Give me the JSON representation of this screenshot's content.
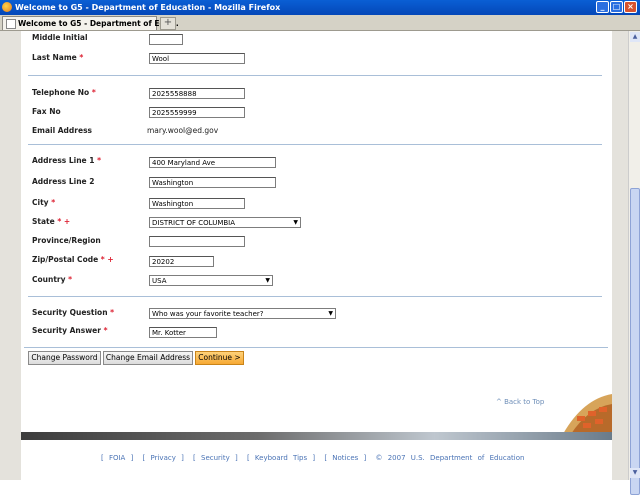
{
  "window": {
    "title": "Welcome to G5 - Department of Education - Mozilla Firefox",
    "tab_label": "Welcome to G5 - Department of Edu...",
    "new_tab_symbol": "+"
  },
  "form": {
    "middle_initial": {
      "label": "Middle Initial",
      "value": ""
    },
    "last_name": {
      "label": "Last Name",
      "value": "Wool"
    },
    "telephone": {
      "label": "Telephone No",
      "value": "2025558888"
    },
    "fax": {
      "label": "Fax No",
      "value": "2025559999"
    },
    "email": {
      "label": "Email Address",
      "value": "mary.wool@ed.gov"
    },
    "address1": {
      "label": "Address Line 1",
      "value": "400 Maryland Ave"
    },
    "address2": {
      "label": "Address Line 2",
      "value": "Washington"
    },
    "city": {
      "label": "City",
      "value": "Washington"
    },
    "state": {
      "label": "State",
      "value": "DISTRICT OF COLUMBIA"
    },
    "province": {
      "label": "Province/Region",
      "value": ""
    },
    "zip": {
      "label": "Zip/Postal Code",
      "value": "20202"
    },
    "country": {
      "label": "Country",
      "value": "USA"
    },
    "security_question": {
      "label": "Security Question",
      "value": "Who was your favorite teacher?"
    },
    "security_answer": {
      "label": "Security Answer",
      "value": "Mr. Kotter"
    },
    "required_marker": "*",
    "state_marker": "+"
  },
  "buttons": {
    "change_password": "Change Password",
    "change_email": "Change Email Address",
    "continue": "Continue >"
  },
  "back_to_top": "^ Back to Top",
  "footer": {
    "foia": "[ FOIA ]",
    "privacy": "[ Privacy ]",
    "security": "[ Security ]",
    "keyboard_tips": "[ Keyboard Tips ]",
    "notices": "[ Notices ]",
    "copyright": "© 2007 U.S. Department of Education"
  },
  "colors": {
    "titlebar": "#0a5fd4",
    "required": "#d23",
    "primary_button": "#f7a934",
    "link": "#4a73b5"
  }
}
